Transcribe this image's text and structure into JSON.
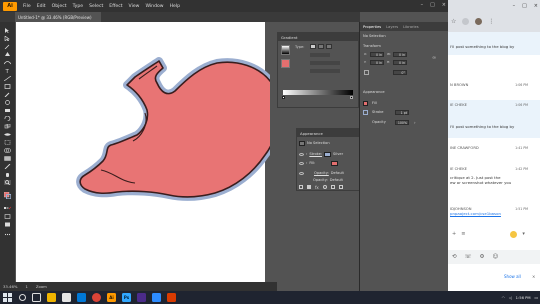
{
  "illustrator": {
    "logo": "Ai",
    "menu": [
      "File",
      "Edit",
      "Object",
      "Type",
      "Select",
      "Effect",
      "View",
      "Window",
      "Help"
    ],
    "doc_tab": "Untitled-1* @ 33.46% (RGB/Preview)",
    "status": {
      "zoom": "33.46%",
      "artboard": "1",
      "mode": "Zoom"
    }
  },
  "gradient_panel": {
    "title": "Gradient",
    "type_label": "Type:",
    "accent": "#e36f6f"
  },
  "appearance_panel": {
    "title": "Appearance",
    "no_selection": "No Selection",
    "stroke_label": "Stroke:",
    "stroke_value": "Silver",
    "fill_label": "Fill:",
    "opacity_label": "Opacity:",
    "opacity_value": "Default",
    "opacity2_label": "Opacity:",
    "opacity2_value": "Default"
  },
  "properties_panel": {
    "tabs": [
      "Properties",
      "Layers",
      "Libraries"
    ],
    "no_selection": "No Selection",
    "transform_label": "Transform",
    "appearance_label": "Appearance",
    "fill_label": "Fill",
    "stroke_label": "Stroke",
    "stroke_weight": "1 pt",
    "opacity_label": "Opacity",
    "opacity_value": "100%",
    "x_value": "0 in",
    "y_value": "0 in",
    "w_value": "0 in",
    "h_value": "0 in",
    "angle_value": "0°"
  },
  "chat": {
    "messages": [
      {
        "name": "",
        "text": "I'll post something to the blog by",
        "time": ""
      },
      {
        "name": "N BROWN",
        "text": "",
        "time": "1:06 PM"
      },
      {
        "name": "IE CHEKE",
        "text": "",
        "time": "1:06 PM"
      },
      {
        "name": "",
        "text": "I'll post something to the blog by",
        "time": ""
      },
      {
        "name": "INE CRAWFORD",
        "text": "",
        "time": "1:41 PM"
      },
      {
        "name": "IE CHEKE",
        "text": "critique at 2. Just post the",
        "time": "1:42 PM"
      },
      {
        "name": "",
        "text": "ew or screenshot whatever you",
        "time": ""
      },
      {
        "name": "IDJOHNSON",
        "text": "pnpaoject.com/cse1bason",
        "time": "1:51 PM"
      }
    ],
    "show_all": "Show all"
  },
  "taskbar": {
    "time": "1:56 PM",
    "date": ""
  },
  "colors": {
    "stomach_fill": "#e87474",
    "stomach_halo": "#9baed0",
    "stomach_outline": "#3a1d1d",
    "ai_orange": "#ff9a00"
  }
}
